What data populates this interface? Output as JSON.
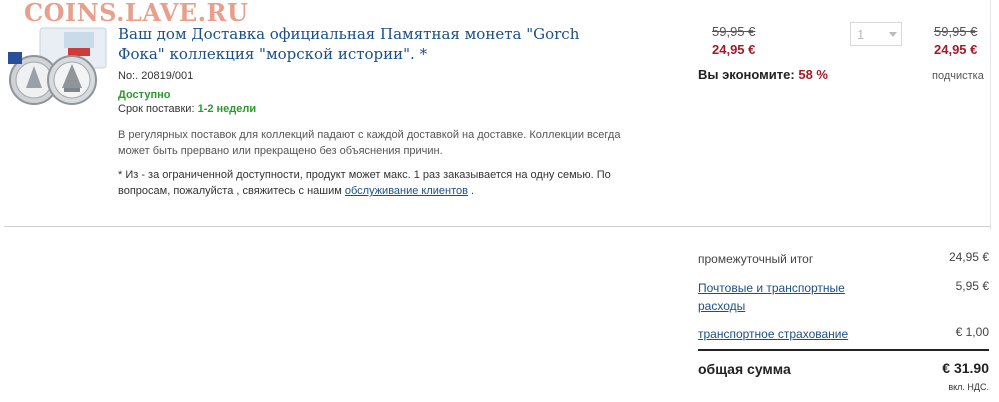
{
  "watermark": "COINS.LAVE.RU",
  "product": {
    "title": "Ваш дом Доставка официальная Памятная монета \"Gorch Фока\" коллекция \"морской истории\". *",
    "sku": "No:. 20819/001",
    "availability": "Доступно",
    "delivery_label": "Срок поставки:",
    "delivery_value": "1-2 недели",
    "note1": "В регулярных поставок для коллекций падают с каждой доставкой на доставке. Коллекции всегда может быть прервано или прекращено без объяснения причин.",
    "note2_text": "* Из - за ограниченной доступности, продукт может макс. 1 раз заказывается на одну семью. По вопросам, пожалуйста , свяжитесь с нашим",
    "note2_link": "обслуживание клиентов",
    "note2_end": " ."
  },
  "pricing": {
    "old_price": "59,95 €",
    "new_price": "24,95 €",
    "savings_label": "Вы экономите:",
    "savings_value": "58 %",
    "quantity": "1",
    "total_old": "59,95 €",
    "total_new": "24,95 €",
    "subtotal_caption": "подчистка"
  },
  "summary": {
    "subtotal_label": "промежуточный итог",
    "subtotal_value": "24,95 €",
    "shipping_label": "Почтовые и транспортные расходы",
    "shipping_value": "5,95 €",
    "insurance_label": "транспортное страхование",
    "insurance_value": "€ 1,00",
    "total_label": "общая сумма",
    "total_value": "€ 31.90",
    "vat_note": "вкл. НДС."
  },
  "colors": {
    "price_red": "#a01c2a",
    "link_blue": "#1b4f86",
    "available_green": "#2e9a2e"
  }
}
